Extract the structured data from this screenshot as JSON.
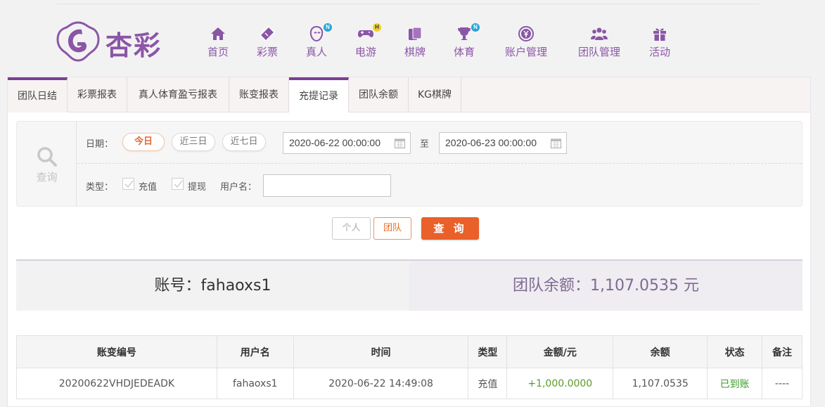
{
  "brand": {
    "name": "杏彩"
  },
  "nav": [
    {
      "label": "首页",
      "icon": "home-icon"
    },
    {
      "label": "彩票",
      "icon": "ticket-icon"
    },
    {
      "label": "真人",
      "icon": "live-dealer-icon",
      "badge": "N"
    },
    {
      "label": "电游",
      "icon": "gamepad-icon",
      "badge": "H"
    },
    {
      "label": "棋牌",
      "icon": "cards-icon"
    },
    {
      "label": "体育",
      "icon": "trophy-icon",
      "badge": "N"
    },
    {
      "label": "账户管理",
      "icon": "yen-coin-icon"
    },
    {
      "label": "团队管理",
      "icon": "team-icon"
    },
    {
      "label": "活动",
      "icon": "gift-icon"
    }
  ],
  "tabs": [
    "团队日结",
    "彩票报表",
    "真人体育盈亏报表",
    "账变报表",
    "充提记录",
    "团队余额",
    "KG棋牌"
  ],
  "active_tab": "充提记录",
  "filter": {
    "query_label": "查询",
    "date_label": "日期：",
    "quick_dates": [
      "今日",
      "近三日",
      "近七日"
    ],
    "start_date": "2020-06-22 00:00:00",
    "to_label": "至",
    "end_date": "2020-06-23 00:00:00",
    "type_label": "类型：",
    "type_options": [
      "充值",
      "提现"
    ],
    "username_label": "用户名：",
    "username_value": ""
  },
  "buttons": {
    "person": "个人",
    "team": "团队",
    "query": "查 询"
  },
  "summary": {
    "account": "账号：fahaoxs1",
    "team_balance": "团队余额：1,107.0535 元"
  },
  "table": {
    "headers": [
      "账变编号",
      "用户名",
      "时间",
      "类型",
      "金额/元",
      "余额",
      "状态",
      "备注"
    ],
    "rows": [
      [
        "20200622VHDJEDEADK",
        "fahaoxs1",
        "2020-06-22 14:49:08",
        "充值",
        "+1,000.0000",
        "1,107.0535",
        "已到账",
        "----"
      ]
    ]
  },
  "colors": {
    "brand_purple": "#8a56a6",
    "accent_orange": "#e9602a",
    "tab_active": "#7b3f91",
    "positive_green": "#5a9a2a"
  }
}
